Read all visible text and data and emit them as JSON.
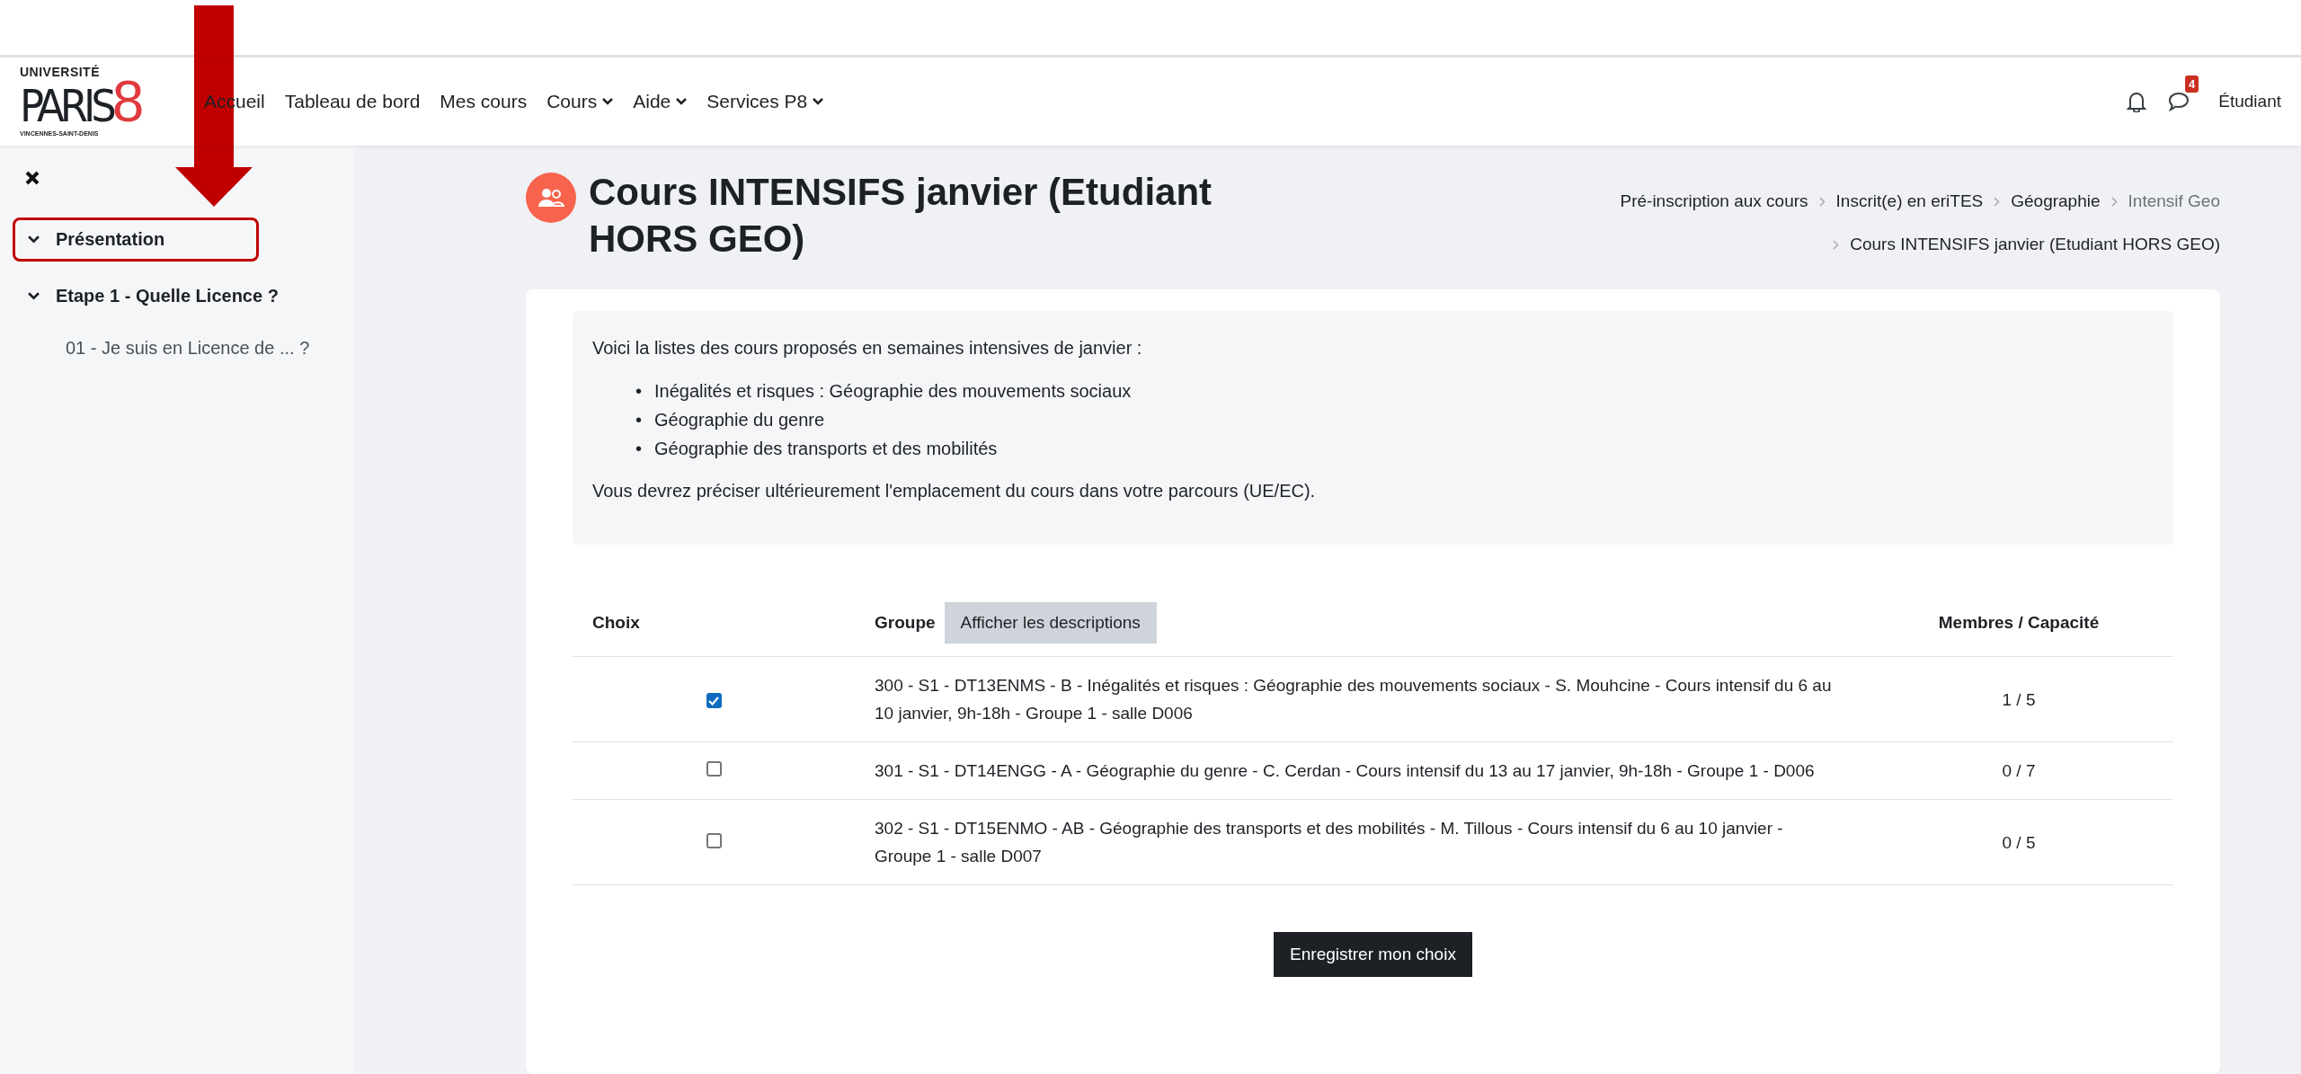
{
  "logo": {
    "top": "UNIVERSITÉ",
    "name": "PARIS",
    "number": "8",
    "bottom": "VINCENNES-SAINT-DENIS"
  },
  "nav": [
    {
      "label": "Accueil",
      "dropdown": false
    },
    {
      "label": "Tableau de bord",
      "dropdown": false
    },
    {
      "label": "Mes cours",
      "dropdown": false
    },
    {
      "label": "Cours",
      "dropdown": true
    },
    {
      "label": "Aide",
      "dropdown": true
    },
    {
      "label": "Services P8",
      "dropdown": true
    }
  ],
  "user": {
    "messages_badge": "4",
    "name": "Étudiant"
  },
  "sidebar": {
    "items": [
      {
        "label": "Présentation",
        "highlighted": true,
        "expanded": true
      },
      {
        "label": "Etape 1 - Quelle Licence ?",
        "highlighted": false,
        "expanded": true,
        "children": [
          {
            "label": "01 - Je suis en Licence de ... ?"
          }
        ]
      }
    ]
  },
  "page": {
    "title": "Cours INTENSIFS janvier (Etudiant HORS GEO)",
    "breadcrumb": [
      {
        "label": "Pré-inscription aux cours",
        "current": false
      },
      {
        "label": "Inscrit(e) en eriTES",
        "current": false
      },
      {
        "label": "Géographie",
        "current": false
      },
      {
        "label": "Intensif Geo",
        "current": true
      },
      {
        "label": "Cours INTENSIFS janvier (Etudiant HORS GEO)",
        "current": false
      }
    ]
  },
  "description": {
    "intro": "Voici la listes des cours proposés en semaines intensives de janvier :",
    "items": [
      {
        "bullet": "•",
        "text": "Inégalités et risques : Géographie des mouvements sociaux"
      },
      {
        "bullet": "•",
        "text": "Géographie du genre"
      },
      {
        "bullet": "•",
        "text": "Géographie des transports et des mobilités"
      }
    ],
    "note": "Vous devrez préciser ultérieurement l'emplacement du cours dans votre parcours (UE/EC)."
  },
  "table": {
    "columns": [
      "Choix",
      "Groupe",
      "Membres / Capacité"
    ],
    "toggle_button": "Afficher les descriptions",
    "rows": [
      {
        "checked": true,
        "group": "300 - S1 - DT13ENMS - B - Inégalités et risques : Géographie des mouvements sociaux - S. Mouhcine - Cours intensif du 6 au 10 janvier, 9h-18h - Groupe 1 - salle D006",
        "members": "1 / 5"
      },
      {
        "checked": false,
        "group": "301 - S1 - DT14ENGG - A - Géographie du genre - C. Cerdan - Cours intensif du 13 au 17 janvier, 9h-18h - Groupe 1 - D006",
        "members": "0 / 7"
      },
      {
        "checked": false,
        "group": "302 - S1 - DT15ENMO - AB - Géographie des transports et des mobilités - M. Tillous - Cours intensif du 6 au 10 janvier - Groupe 1 - salle D007",
        "members": "0 / 5"
      }
    ]
  },
  "submit": "Enregistrer mon choix"
}
